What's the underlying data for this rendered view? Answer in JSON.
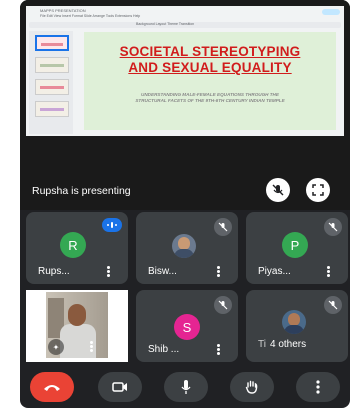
{
  "presentation": {
    "doc_title": "MAPPS PRESENTATION",
    "menu": "File  Edit  View  Insert  Format  Slide  Arrange  Tools  Extensions  Help",
    "toolbar": "Background   Layout   Theme   Transition",
    "slide_title_line1": "SOCIETAL STEREOTYPING",
    "slide_title_line2": "AND SEXUAL EQUALITY",
    "slide_subtitle_line1": "UNDERSTANDING MALE-FEMALE EQUATIONS THROUGH THE",
    "slide_subtitle_line2": "STRUCTURAL FACETS OF THE 9TH-6TH CENTURY INDIAN TEMPLE",
    "presenter_text": "Rupsha is presenting",
    "colors": {
      "title": "#d11c1c",
      "slide_bg": "#dff0d8"
    }
  },
  "participants": [
    {
      "initial": "R",
      "name": "Rups...",
      "avatar_color": "#34a853",
      "status": "speaking"
    },
    {
      "initial": "",
      "name": "Bisw...",
      "status": "muted",
      "has_photo": true
    },
    {
      "initial": "P",
      "name": "Piyas...",
      "avatar_color": "#34a853",
      "status": "muted"
    },
    {
      "initial": "",
      "name": "",
      "status": "self-video"
    },
    {
      "initial": "S",
      "name": "Shib ...",
      "avatar_color": "#e52592",
      "status": "muted"
    },
    {
      "initial": "",
      "name": "Ti",
      "others_label": "4 others",
      "status": "muted"
    }
  ],
  "controls": [
    "end-call",
    "camera",
    "microphone",
    "raise-hand",
    "more"
  ],
  "icons": [
    "mute-mic-icon",
    "fullscreen-icon",
    "mic-off-icon",
    "audio-levels-icon",
    "sparkle-effects-icon",
    "phone-end-icon",
    "video-camera-icon",
    "mic-icon",
    "hand-icon",
    "more-vert-icon"
  ]
}
